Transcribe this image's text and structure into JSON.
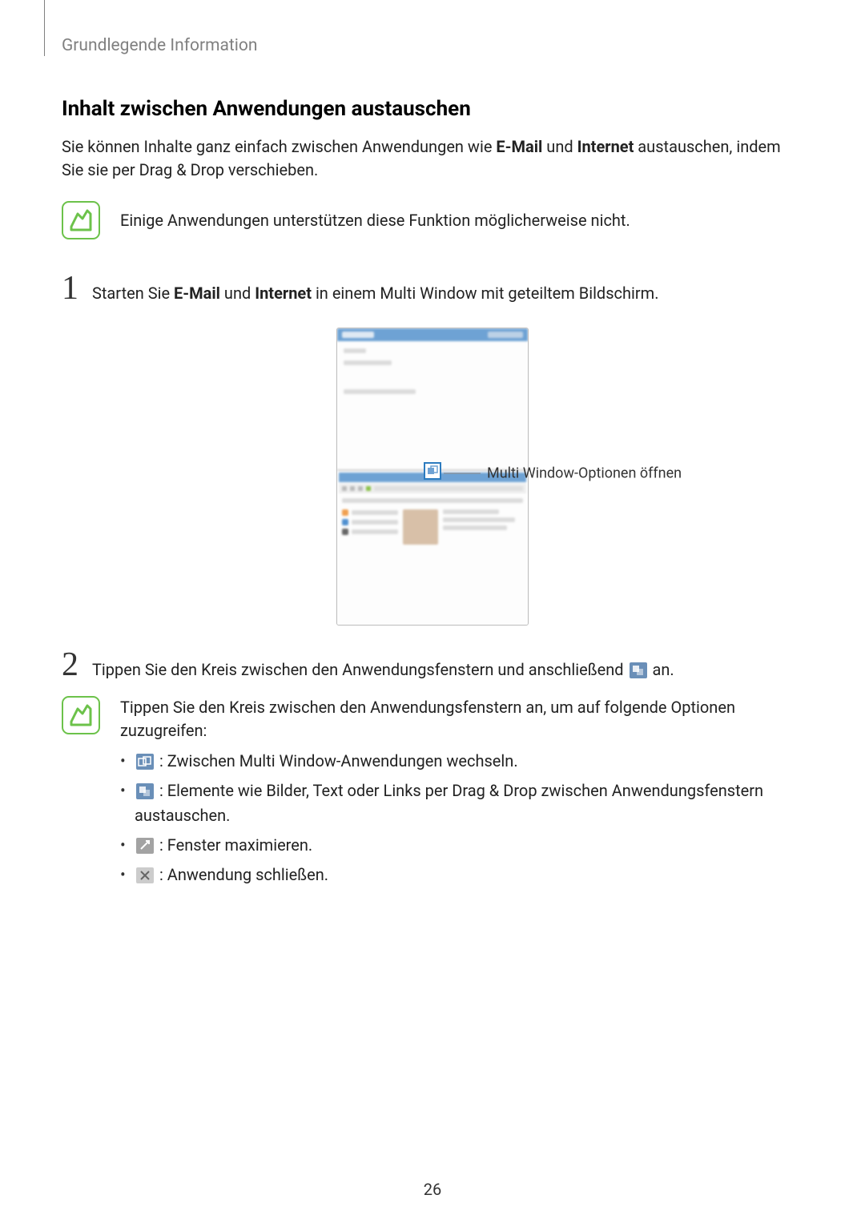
{
  "breadcrumb": "Grundlegende Information",
  "heading": "Inhalt zwischen Anwendungen austauschen",
  "intro": {
    "pre": "Sie können Inhalte ganz einfach zwischen Anwendungen wie ",
    "b1": "E-Mail",
    "mid": " und ",
    "b2": "Internet",
    "post": " austauschen, indem Sie sie per Drag & Drop verschieben."
  },
  "note1": "Einige Anwendungen unterstützen diese Funktion möglicherweise nicht.",
  "step1": {
    "num": "1",
    "pre": "Starten Sie ",
    "b1": "E-Mail",
    "mid": " und ",
    "b2": "Internet",
    "post": " in einem Multi Window mit geteiltem Bildschirm."
  },
  "callout": "Multi Window-Optionen öffnen",
  "step2": {
    "num": "2",
    "pre": "Tippen Sie den Kreis zwischen den Anwendungsfenstern und anschließend ",
    "post": " an."
  },
  "note2": {
    "intro": "Tippen Sie den Kreis zwischen den Anwendungsfenstern an, um auf folgende Optionen zuzugreifen:",
    "opt1": " : Zwischen Multi Window-Anwendungen wechseln.",
    "opt2": " : Elemente wie Bilder, Text oder Links per Drag & Drop zwischen Anwendungsfenstern austauschen.",
    "opt3": " : Fenster maximieren.",
    "opt4": " : Anwendung schließen."
  },
  "page_num": "26"
}
